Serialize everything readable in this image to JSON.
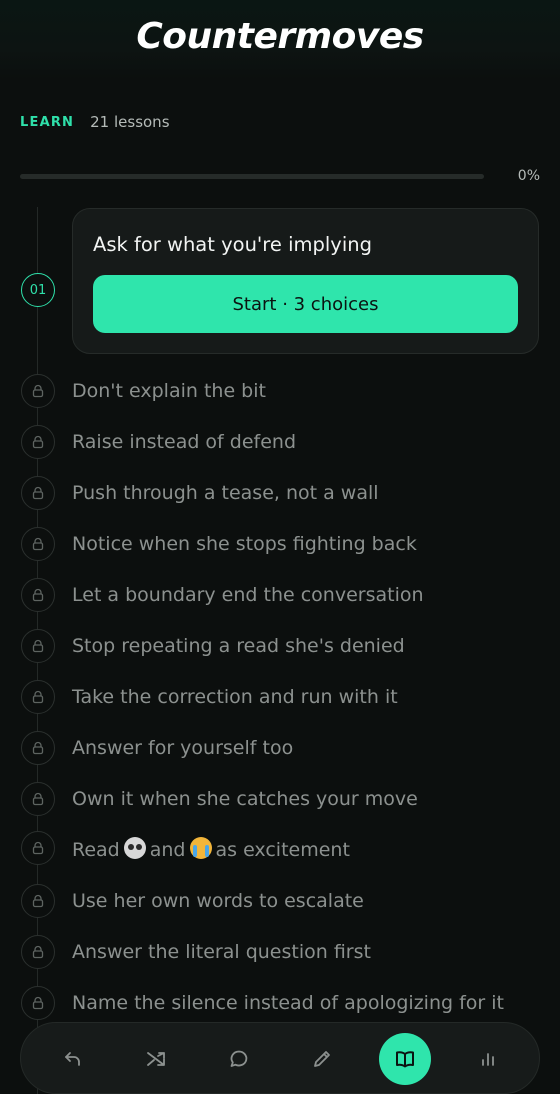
{
  "app": {
    "title": "Countermoves"
  },
  "section": {
    "tag": "LEARN",
    "lesson_count": "21 lessons"
  },
  "progress": {
    "value_percent": 0,
    "label": "0%"
  },
  "current_lesson": {
    "number": "01",
    "title": "Ask for what you're implying",
    "button_label": "Start · 3 choices"
  },
  "lessons": [
    {
      "label": "Don't explain the bit"
    },
    {
      "label": "Raise instead of defend"
    },
    {
      "label": "Push through a tease, not a wall"
    },
    {
      "label": "Notice when she stops fighting back"
    },
    {
      "label": "Let a boundary end the conversation"
    },
    {
      "label": "Stop repeating a read she's denied"
    },
    {
      "label": "Take the correction and run with it"
    },
    {
      "label": "Answer for yourself too"
    },
    {
      "label": "Own it when she catches your move"
    },
    {
      "label_parts": [
        "Read",
        "and",
        "as excitement"
      ],
      "emojis": [
        "skull-emoji",
        "loudly-crying-emoji"
      ]
    },
    {
      "label": "Use her own words to escalate"
    },
    {
      "label": "Answer the literal question first"
    },
    {
      "label": "Name the silence instead of apologizing for it"
    }
  ],
  "nav": {
    "items": [
      {
        "icon": "undo-icon",
        "active": false
      },
      {
        "icon": "shuffle-icon",
        "active": false
      },
      {
        "icon": "chat-bubble-icon",
        "active": false
      },
      {
        "icon": "pencil-icon",
        "active": false
      },
      {
        "icon": "book-icon",
        "active": true
      },
      {
        "icon": "bar-chart-icon",
        "active": false
      }
    ]
  },
  "colors": {
    "accent": "#2fe5ac",
    "background": "#0c0f0e",
    "card": "#161a19",
    "muted_text": "#8c918f"
  }
}
